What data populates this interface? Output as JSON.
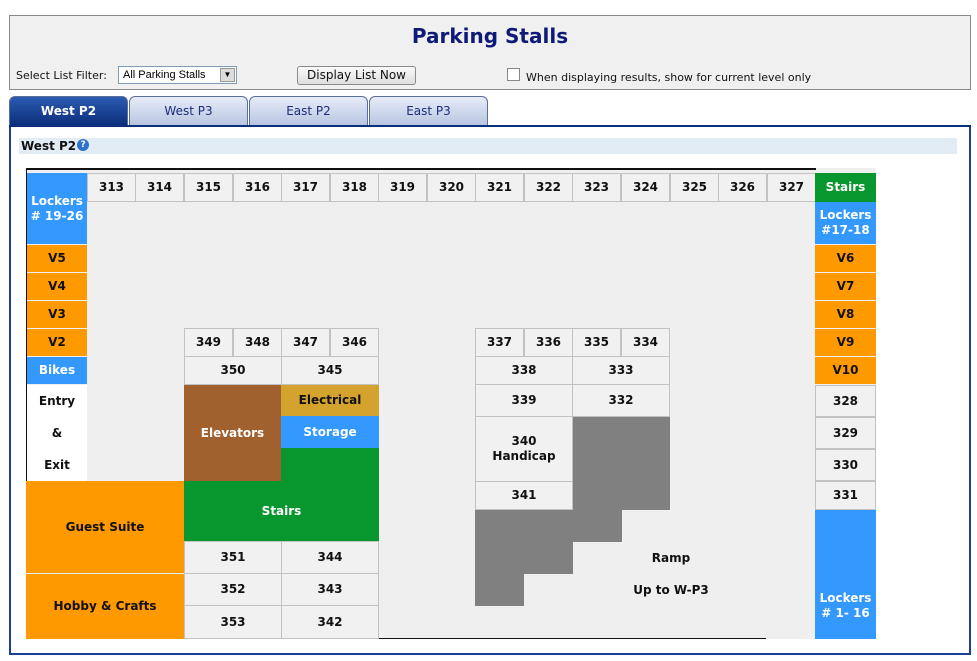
{
  "header": {
    "title": "Parking Stalls",
    "filter_label": "Select List Filter:",
    "filter_value": "All Parking Stalls",
    "display_button": "Display List Now",
    "checkbox_label": "When displaying results, show for current level only"
  },
  "tabs": [
    "West P2",
    "West P3",
    "East P2",
    "East P3"
  ],
  "active_tab": "West P2",
  "section_title": "West P2",
  "help_icon": "?",
  "colors": {
    "blue": "#3399ff",
    "orange": "#ff9900",
    "green": "#08962e",
    "brown": "#a0612f",
    "gold": "#d4a32e",
    "gray": "#808080",
    "navy": "#0c2f7c"
  },
  "map": {
    "top_row": [
      "313",
      "314",
      "315",
      "316",
      "317",
      "318",
      "319",
      "320",
      "321",
      "322",
      "323",
      "324",
      "325",
      "326",
      "327"
    ],
    "left_column": [
      "Lockers\n# 19-26",
      "V5",
      "V4",
      "V3",
      "V2",
      "Bikes"
    ],
    "entry": [
      "Entry",
      "&",
      "Exit"
    ],
    "right_column": [
      "Stairs",
      "Lockers\n#17-18",
      "V6",
      "V7",
      "V8",
      "V9",
      "V10",
      "328",
      "329",
      "330",
      "331",
      "Lockers\n# 1- 16"
    ],
    "block_a": [
      "349",
      "348",
      "347",
      "346",
      "350",
      "345",
      "Elevators",
      "Electrical",
      "Storage",
      "Stairs",
      "351",
      "344",
      "352",
      "343",
      "353",
      "342"
    ],
    "block_b": [
      "337",
      "336",
      "335",
      "334",
      "338",
      "333",
      "339",
      "332",
      "340\nHandicap",
      "341"
    ],
    "guest_suite": "Guest Suite",
    "hobby": "Hobby & Crafts",
    "ramp": "Ramp",
    "ramp_sub": "Up to W-P3"
  }
}
